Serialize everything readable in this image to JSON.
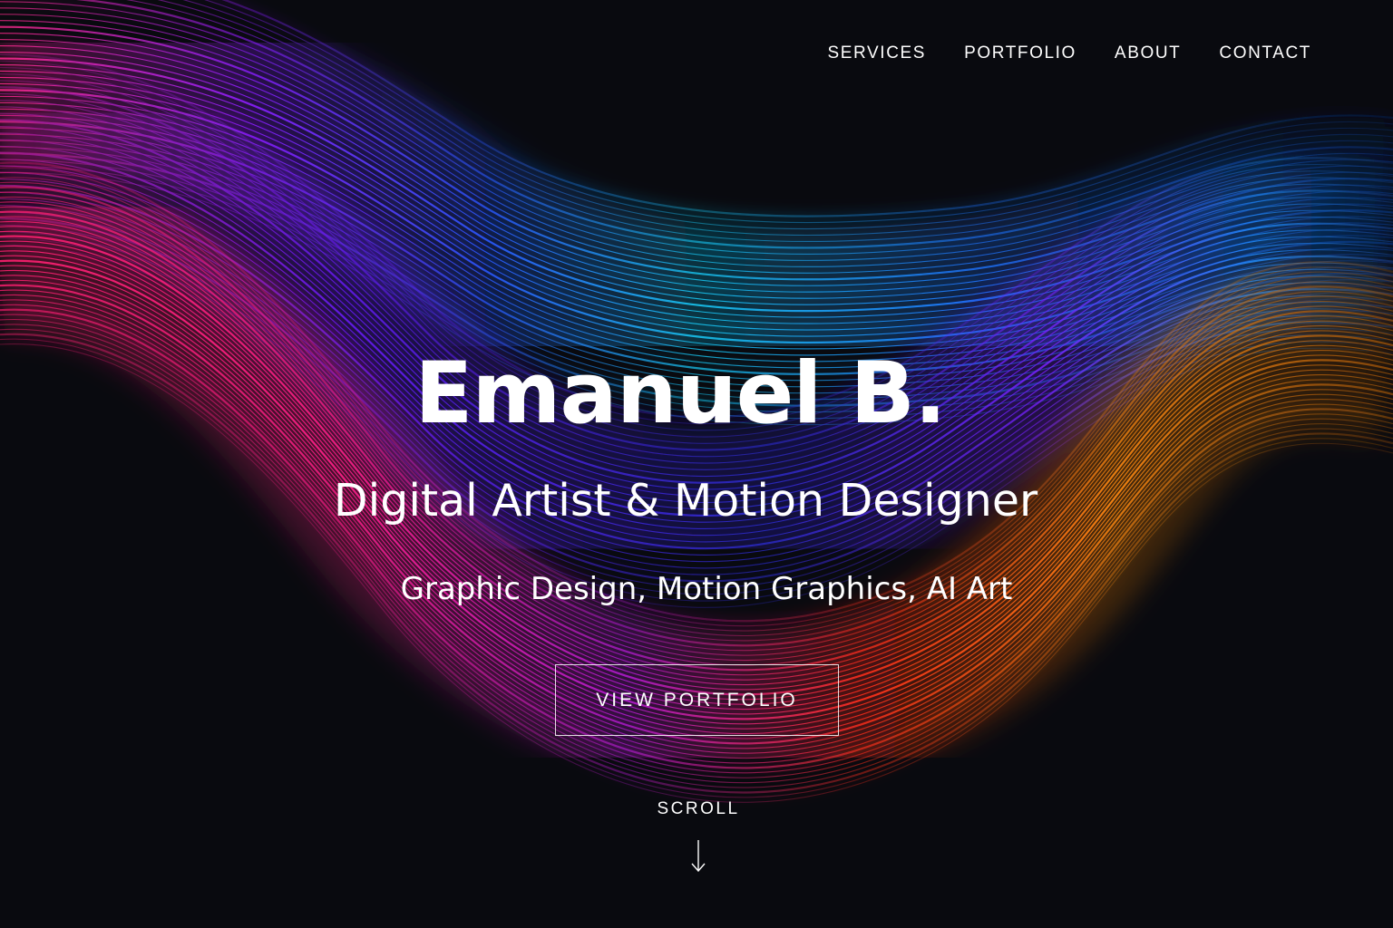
{
  "nav": {
    "items": [
      {
        "label": "SERVICES"
      },
      {
        "label": "PORTFOLIO"
      },
      {
        "label": "ABOUT"
      },
      {
        "label": "CONTACT"
      }
    ]
  },
  "hero": {
    "name": "Emanuel B.",
    "role": "Digital Artist & Motion Designer",
    "skills": "Graphic Design, Motion Graphics, AI Art",
    "cta_label": "VIEW PORTFOLIO"
  },
  "scroll": {
    "label": "SCROLL",
    "icon": "arrow-down-icon"
  },
  "colors": {
    "background": "#090a0f",
    "text": "#ffffff",
    "wave_cyan": "#19c8f0",
    "wave_blue": "#1e6cff",
    "wave_violet": "#6a1bff",
    "wave_magenta": "#ff1f7a",
    "wave_red": "#ff2e1a",
    "wave_orange": "#ff8a12",
    "wave_yellow": "#ffc21a"
  }
}
